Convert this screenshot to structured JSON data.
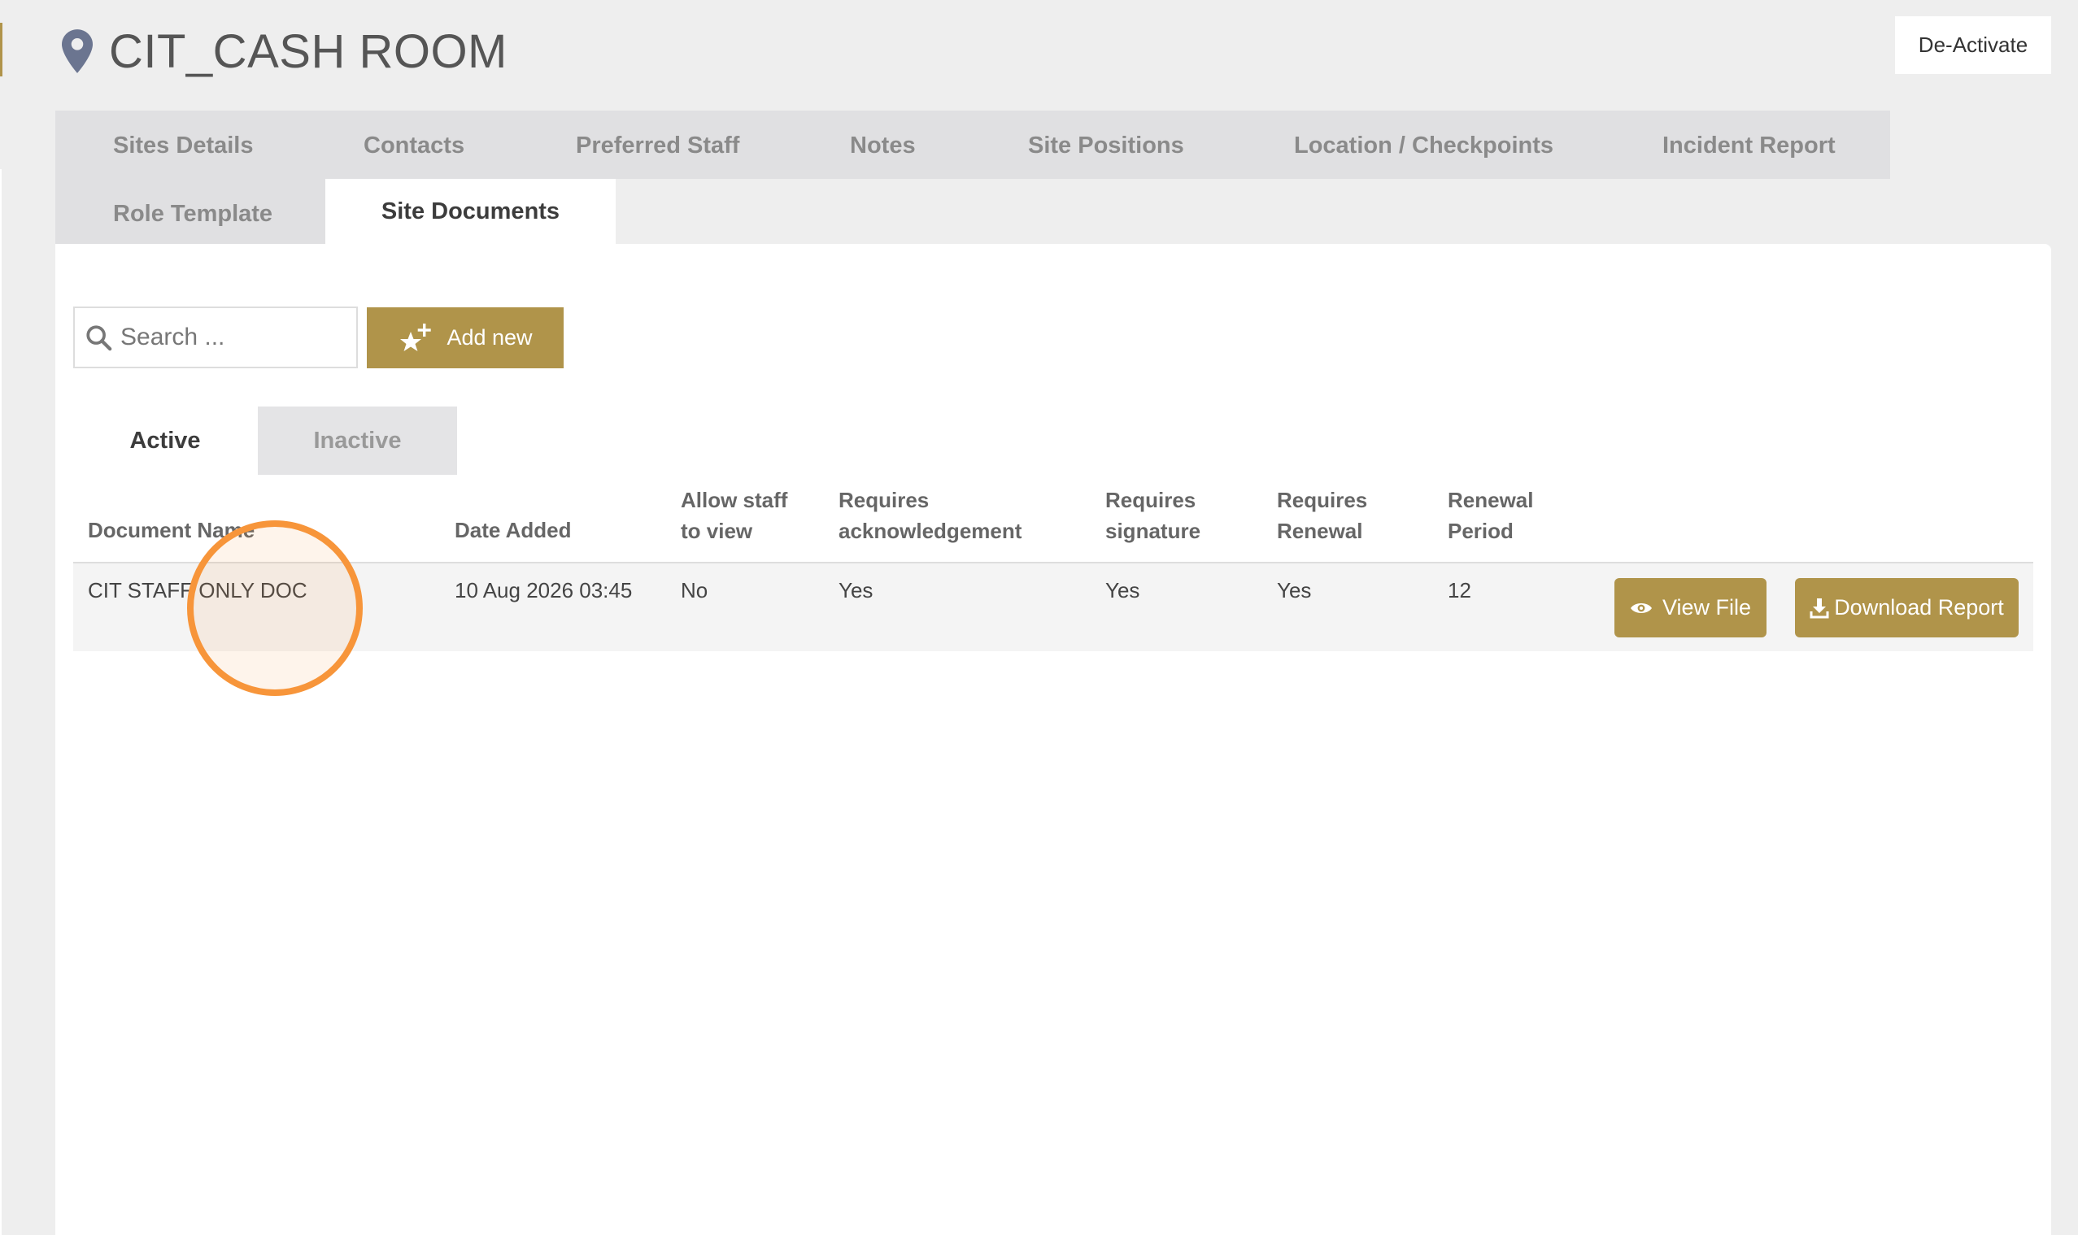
{
  "page": {
    "title": "CIT_CASH ROOM"
  },
  "actions": {
    "deactivate_label": "De-Activate"
  },
  "tabs": [
    {
      "label": "Sites Details"
    },
    {
      "label": "Contacts"
    },
    {
      "label": "Preferred Staff"
    },
    {
      "label": "Notes"
    },
    {
      "label": "Site Positions"
    },
    {
      "label": "Location / Checkpoints"
    },
    {
      "label": "Incident Report"
    },
    {
      "label": "Role Template"
    },
    {
      "label": "Site Documents",
      "active": true
    }
  ],
  "toolbar": {
    "search_placeholder": "Search ...",
    "add_label": "Add new"
  },
  "status_tabs": {
    "active_label": "Active",
    "inactive_label": "Inactive"
  },
  "table": {
    "headers": {
      "document_name": "Document Name",
      "date_added": "Date Added",
      "allow_staff_1": "Allow staff",
      "allow_staff_2": "to view",
      "req_ack_1": "Requires",
      "req_ack_2": "acknowledgement",
      "req_sig_1": "Requires",
      "req_sig_2": "signature",
      "req_renew_1": "Requires",
      "req_renew_2": "Renewal",
      "renewal_1": "Renewal",
      "renewal_2": "Period"
    },
    "rows": [
      {
        "document_name": "CIT STAFF ONLY DOC",
        "date_added": "10 Aug 2026 03:45",
        "allow_staff": "No",
        "requires_ack": "Yes",
        "requires_sig": "Yes",
        "requires_renewal": "Yes",
        "renewal_period": "12",
        "view_label": "View File",
        "download_label": "Download Report"
      }
    ]
  },
  "colors": {
    "accent": "#b0944a",
    "marker": "#f7953a",
    "pin": "#6b7590"
  },
  "icons": [
    "location-pin-icon",
    "search-icon",
    "star-plus-icon",
    "eye-icon",
    "download-icon"
  ]
}
